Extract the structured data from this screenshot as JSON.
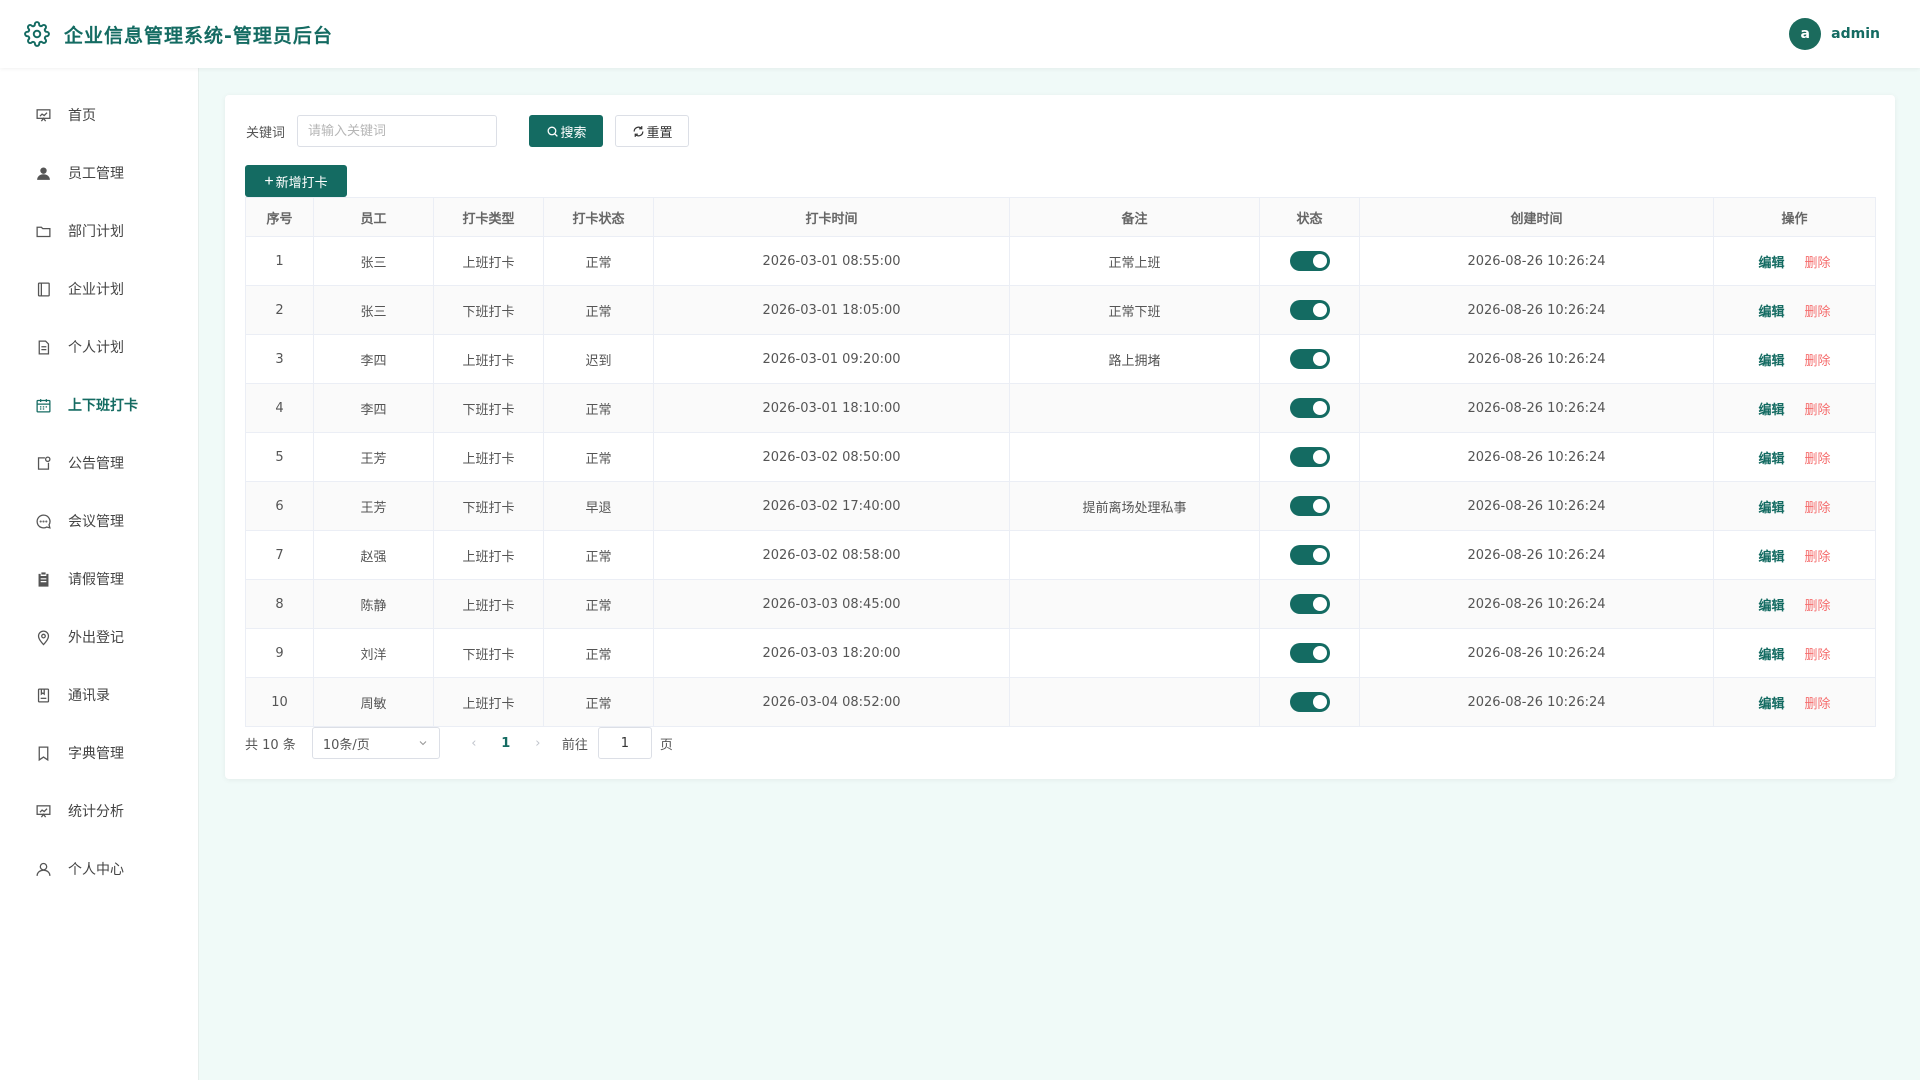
{
  "header": {
    "title": "企业信息管理系统-管理员后台",
    "logo_icon": "gear-icon",
    "avatar_letter": "a",
    "username": "admin"
  },
  "sidebar": {
    "items": [
      {
        "label": "首页",
        "icon": "presentation-icon"
      },
      {
        "label": "员工管理",
        "icon": "user-icon"
      },
      {
        "label": "部门计划",
        "icon": "folder-icon"
      },
      {
        "label": "企业计划",
        "icon": "notebook-icon"
      },
      {
        "label": "个人计划",
        "icon": "document-icon"
      },
      {
        "label": "上下班打卡",
        "icon": "calendar-icon",
        "active": true
      },
      {
        "label": "公告管理",
        "icon": "notice-icon"
      },
      {
        "label": "会议管理",
        "icon": "chat-icon"
      },
      {
        "label": "请假管理",
        "icon": "clipboard-icon"
      },
      {
        "label": "外出登记",
        "icon": "location-icon"
      },
      {
        "label": "通讯录",
        "icon": "contacts-icon"
      },
      {
        "label": "字典管理",
        "icon": "bookmark-icon"
      },
      {
        "label": "统计分析",
        "icon": "chart-icon"
      },
      {
        "label": "个人中心",
        "icon": "user-outline-icon"
      }
    ]
  },
  "search": {
    "label": "关键词",
    "placeholder": "请输入关键词",
    "value": "",
    "search_label": "搜索",
    "reset_label": "重置"
  },
  "toolbar": {
    "add_label": "新增打卡"
  },
  "table": {
    "columns": [
      "序号",
      "员工",
      "打卡类型",
      "打卡状态",
      "打卡时间",
      "备注",
      "状态",
      "创建时间",
      "操作"
    ],
    "edit_label": "编辑",
    "delete_label": "删除",
    "rows": [
      {
        "index": "1",
        "employee": "张三",
        "type": "上班打卡",
        "status": "正常",
        "time": "2026-03-01 08:55:00",
        "note": "正常上班",
        "enabled": true,
        "created": "2026-08-26 10:26:24"
      },
      {
        "index": "2",
        "employee": "张三",
        "type": "下班打卡",
        "status": "正常",
        "time": "2026-03-01 18:05:00",
        "note": "正常下班",
        "enabled": true,
        "created": "2026-08-26 10:26:24"
      },
      {
        "index": "3",
        "employee": "李四",
        "type": "上班打卡",
        "status": "迟到",
        "time": "2026-03-01 09:20:00",
        "note": "路上拥堵",
        "enabled": true,
        "created": "2026-08-26 10:26:24"
      },
      {
        "index": "4",
        "employee": "李四",
        "type": "下班打卡",
        "status": "正常",
        "time": "2026-03-01 18:10:00",
        "note": "",
        "enabled": true,
        "created": "2026-08-26 10:26:24"
      },
      {
        "index": "5",
        "employee": "王芳",
        "type": "上班打卡",
        "status": "正常",
        "time": "2026-03-02 08:50:00",
        "note": "",
        "enabled": true,
        "created": "2026-08-26 10:26:24"
      },
      {
        "index": "6",
        "employee": "王芳",
        "type": "下班打卡",
        "status": "早退",
        "time": "2026-03-02 17:40:00",
        "note": "提前离场处理私事",
        "enabled": true,
        "created": "2026-08-26 10:26:24"
      },
      {
        "index": "7",
        "employee": "赵强",
        "type": "上班打卡",
        "status": "正常",
        "time": "2026-03-02 08:58:00",
        "note": "",
        "enabled": true,
        "created": "2026-08-26 10:26:24"
      },
      {
        "index": "8",
        "employee": "陈静",
        "type": "上班打卡",
        "status": "正常",
        "time": "2026-03-03 08:45:00",
        "note": "",
        "enabled": true,
        "created": "2026-08-26 10:26:24"
      },
      {
        "index": "9",
        "employee": "刘洋",
        "type": "下班打卡",
        "status": "正常",
        "time": "2026-03-03 18:20:00",
        "note": "",
        "enabled": true,
        "created": "2026-08-26 10:26:24"
      },
      {
        "index": "10",
        "employee": "周敏",
        "type": "上班打卡",
        "status": "正常",
        "time": "2026-03-04 08:52:00",
        "note": "",
        "enabled": true,
        "created": "2026-08-26 10:26:24"
      }
    ]
  },
  "pagination": {
    "total_text": "共 10 条",
    "page_size": "10条/页",
    "current_page": "1",
    "goto_label": "前往",
    "goto_value": "1",
    "page_unit": "页"
  },
  "colors": {
    "primary": "#146b62",
    "danger": "#f56c6c",
    "background": "#f0faf8"
  }
}
